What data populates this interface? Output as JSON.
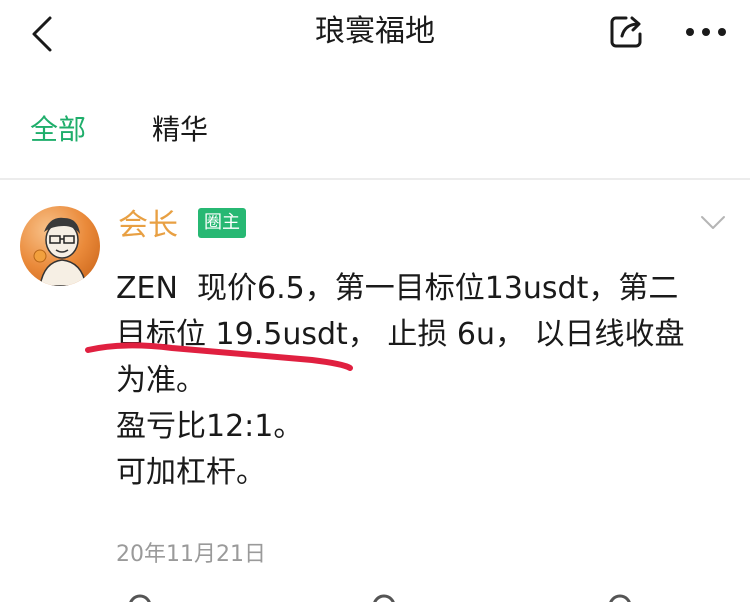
{
  "nav": {
    "title": "琅寰福地",
    "back_icon": "chevron-left-icon",
    "share_icon": "share-icon",
    "more_icon": "more-dots-icon"
  },
  "tabs": [
    {
      "label": "全部",
      "active": true
    },
    {
      "label": "精华",
      "active": false
    }
  ],
  "colors": {
    "accent": "#1fae6b",
    "author": "#e8a043",
    "badge": "#27b873",
    "underline": "#e02040",
    "date": "#9a9a9a"
  },
  "post": {
    "author": "会长",
    "badge": "圈主",
    "lines": [
      "ZEN  现价6.5，第一目标位13usdt，第二",
      "目标位 19.5usdt， 止损 6u， 以日线收盘",
      "为准。",
      "盈亏比12:1。",
      "可加杠杆。"
    ],
    "date": "20年11月21日"
  }
}
